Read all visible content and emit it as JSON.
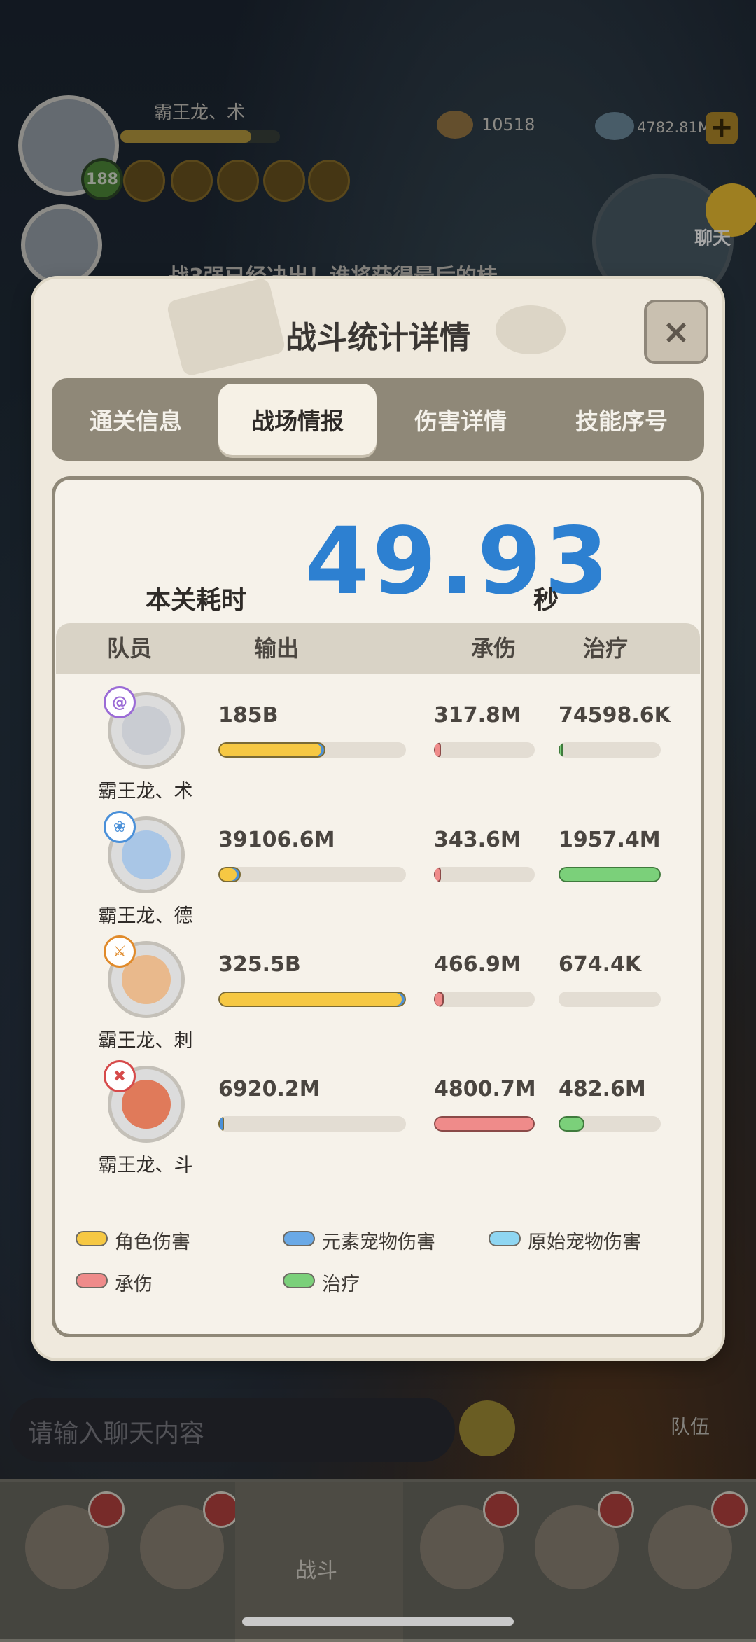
{
  "hud": {
    "player_name": "霸王龙、术",
    "level": "188",
    "coins": "10518",
    "gems": "4782.81M",
    "plus": "+",
    "chat_label": "聊天",
    "notice_text": "战3强已经决出！谁将获得最后的桂"
  },
  "dialog": {
    "title": "战斗统计详情",
    "close_label": "×",
    "tabs": [
      {
        "label": "通关信息",
        "active": false
      },
      {
        "label": "战场情报",
        "active": true
      },
      {
        "label": "伤害详情",
        "active": false
      },
      {
        "label": "技能序号",
        "active": false
      }
    ],
    "time_label": "本关耗时",
    "time_value": "49.93",
    "time_unit": "秒",
    "columns": [
      "队员",
      "输出",
      "承伤",
      "治疗"
    ],
    "members": [
      {
        "name": "霸王龙、术",
        "class_icon": "swirl-icon",
        "class_color": "#9b6bd6",
        "output": "185B",
        "output_ratio": 0.57,
        "taken": "317.8M",
        "taken_ratio": 0.066,
        "heal": "74598.6K",
        "heal_ratio": 0.04
      },
      {
        "name": "霸王龙、德",
        "class_icon": "leaf-icon",
        "class_color": "#4a90d9",
        "output": "39106.6M",
        "output_ratio": 0.12,
        "taken": "343.6M",
        "taken_ratio": 0.071,
        "heal": "1957.4M",
        "heal_ratio": 1.0
      },
      {
        "name": "霸王龙、刺",
        "class_icon": "daggers-icon",
        "class_color": "#e08a2a",
        "output": "325.5B",
        "output_ratio": 1.0,
        "taken": "466.9M",
        "taken_ratio": 0.097,
        "heal": "674.4K",
        "heal_ratio": 0.0
      },
      {
        "name": "霸王龙、斗",
        "class_icon": "fist-icon",
        "class_color": "#d64a4a",
        "output": "6920.2M",
        "output_ratio": 0.021,
        "taken": "4800.7M",
        "taken_ratio": 1.0,
        "heal": "482.6M",
        "heal_ratio": 0.25
      }
    ],
    "legend": [
      {
        "label": "角色伤害",
        "color": "#f6c843"
      },
      {
        "label": "元素宠物伤害",
        "color": "#6aa9e6"
      },
      {
        "label": "原始宠物伤害",
        "color": "#8fd6f2"
      },
      {
        "label": "承伤",
        "color": "#ef8b8a"
      },
      {
        "label": "治疗",
        "color": "#7bd07a"
      }
    ]
  },
  "bottom": {
    "chat_placeholder": "请输入聊天内容",
    "team_label": "队伍",
    "fight_label": "战斗"
  }
}
